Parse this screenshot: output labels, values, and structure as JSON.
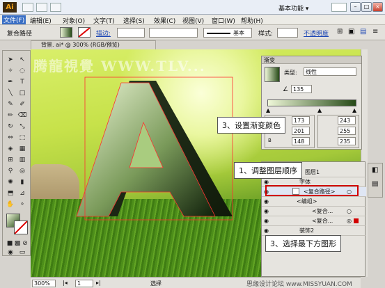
{
  "app": {
    "logo": "Ai",
    "workspace": "基本功能 ▾"
  },
  "menubar": [
    "文件(F)",
    "编辑(E)",
    "对象(O)",
    "文字(T)",
    "选择(S)",
    "效果(C)",
    "视图(V)",
    "窗口(W)",
    "帮助(H)"
  ],
  "controlbar": {
    "object_type": "复合路径",
    "stroke_label": "描边:",
    "style_label": "样式:",
    "opacity_label": "不透明度",
    "stroke_profile": "基本"
  },
  "document": {
    "tab_title": "背景. ai* @ 300% (RGB/预览)",
    "zoom": "300%",
    "page": "1",
    "status": "选择"
  },
  "watermark": "腾龍視覺 WWW.TLV...",
  "gradient_panel": {
    "title": "渐变",
    "type_label": "类型:",
    "type_value": "线性",
    "angle": "135",
    "r1": "173",
    "g1": "201",
    "b1": "148",
    "r2": "243",
    "g2": "255",
    "b2": "235"
  },
  "layers_panel": {
    "layers": [
      {
        "name": "图层1",
        "indent": 0
      },
      {
        "name": "字体",
        "indent": 1
      },
      {
        "name": "<复合路径>",
        "indent": 2
      },
      {
        "name": "<编组>",
        "indent": 2
      },
      {
        "name": "<复合...",
        "indent": 3
      },
      {
        "name": "<复合...",
        "indent": 3
      },
      {
        "name": "装饰2",
        "indent": 1
      }
    ]
  },
  "callouts": {
    "c1": "3、设置渐变颜色",
    "c2": "1、调整图层顺序",
    "c3": "3、选择最下方图形"
  },
  "site_watermark": "思缘设计论坛 www.MISSYUAN.COM"
}
